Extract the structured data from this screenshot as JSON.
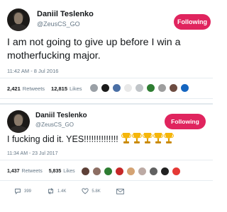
{
  "tweet1": {
    "display_name": "Daniil Teslenko",
    "handle": "@ZeusCS_GO",
    "follow_label": "Following",
    "text_line1": "I am not going to give up before I win a",
    "text_line2": "motherfucking major.",
    "timestamp": "11:42 AM - 8 Jul 2016",
    "retweets_count": "2,421",
    "retweets_label": "Retweets",
    "likes_count": "12,815",
    "likes_label": "Likes",
    "liker_avatar_colors": [
      "#9aa0a6",
      "#1a1a1a",
      "#4a6fa5",
      "#e8e8e8",
      "#c0c4c8",
      "#2e7d32",
      "#9e9e9e",
      "#6d4c41",
      "#1565c0"
    ]
  },
  "tweet2": {
    "display_name": "Daniil Teslenko",
    "handle": "@ZeusCS_GO",
    "follow_label": "Following",
    "text": "I fucking did it. YES!!!!!!!!!!!!!!",
    "trophy_emoji_name": "trophy-emoji",
    "trophy_count": 5,
    "timestamp": "11:34 AM - 23 Jul 2017",
    "retweets_count": "1,437",
    "retweets_label": "Retweets",
    "likes_count": "5,835",
    "likes_label": "Likes",
    "liker_avatar_colors": [
      "#5d4037",
      "#8d6e63",
      "#2e7d32",
      "#c62828",
      "#d4a373",
      "#bcaaa4",
      "#616161",
      "#212121",
      "#e53935"
    ],
    "replies_count": "399",
    "retweet_action_count": "1.4K",
    "like_action_count": "5.8K"
  },
  "colors": {
    "follow_bg": "#e0245e",
    "muted": "#657786",
    "text": "#14171a",
    "divider": "#e1e8ed"
  }
}
